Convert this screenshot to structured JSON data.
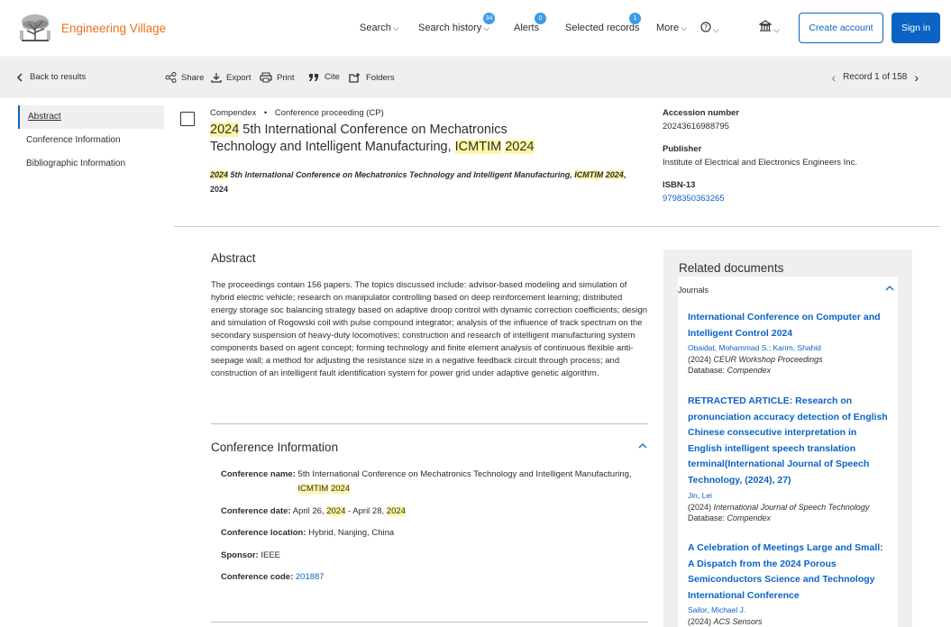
{
  "header": {
    "brand": "Engineering Village",
    "nav": [
      {
        "label": "Search",
        "badge": ""
      },
      {
        "label": "Search history",
        "badge": "34"
      },
      {
        "label": "Alerts",
        "badge": "0"
      },
      {
        "label": "Selected records",
        "badge": "1"
      },
      {
        "label": "More",
        "badge": ""
      }
    ],
    "create_account": "Create account",
    "sign_in": "Sign in"
  },
  "toolbar": {
    "back": "Back to results",
    "share": "Share",
    "export": "Export",
    "print": "Print",
    "cite": "Cite",
    "folders": "Folders",
    "record": "Record 1 of 158"
  },
  "leftnav": [
    "Abstract",
    "Conference Information",
    "Bibliographic Information"
  ],
  "record": {
    "database": "Compendex",
    "doc_type": "Conference proceeding (CP)",
    "title_year": "2024",
    "title_mid": " 5th International Conference on Mechatronics Technology and Intelligent Manufacturing, ",
    "title_acr": "ICMTIM",
    "title_space": " ",
    "title_year2": "2024",
    "source_year": "2024",
    "source_mid": " 5th International Conference on Mechatronics Technology and Intelligent Manufacturing, ",
    "source_acr": "ICMTIM",
    "source_year2": "2024",
    "source_tail": ", 2024"
  },
  "side": {
    "accession_label": "Accession number",
    "accession_value": "20243616988795",
    "publisher_label": "Publisher",
    "publisher_value": "Institute of Electrical and Electronics Engineers Inc.",
    "isbn_label": "ISBN-13",
    "isbn_value": "9798350363265"
  },
  "abstract": {
    "heading": "Abstract",
    "text": "The proceedings contain 156 papers. The topics discussed include: advisor-based modeling and simulation of hybrid electric vehicle; research on manipulator controlling based on deep reinforcement learning; distributed energy storage soc balancing strategy based on adaptive droop control with dynamic correction coefficients; design and simulation of Rogowski coil with pulse compound integrator; analysis of the influence of track spectrum on the secondary suspension of heavy-duty locomotives; construction and research of intelligent manufacturing system components based on agent concept; forming technology and finite element analysis of continuous flexible anti-seepage wall; a method for adjusting the resistance size in a negative feedback circuit through process; and construction of an intelligent fault identification system for power grid under adaptive genetic algorithm."
  },
  "conference": {
    "heading": "Conference Information",
    "name_label": "Conference name:",
    "name_value": "5th International Conference on Mechatronics Technology and Intelligent Manufacturing, ",
    "name_acr": "ICMTIM",
    "name_year": "2024",
    "date_label": "Conference date:",
    "date_start": "April 26, ",
    "date_y1": "2024",
    "date_mid": " - April 28, ",
    "date_y2": "2024",
    "location_label": "Conference location:",
    "location_value": "Hybrid, Nanjing, China",
    "sponsor_label": "Sponsor:",
    "sponsor_value": "IEEE",
    "code_label": "Conference code:",
    "code_value": "201887"
  },
  "related": {
    "heading": "Related documents",
    "group": "Journals",
    "items": [
      {
        "title": "International Conference on Computer and Intelligent Control 2024",
        "authors": "Obaidat, Mohammad S.; Karim, Shahid",
        "year": "(2024) ",
        "source": "CEUR Workshop Proceedings",
        "db_label": "Database: ",
        "db": "Compendex"
      },
      {
        "title": "RETRACTED ARTICLE: Research on pronunciation accuracy detection of English Chinese consecutive interpretation in English intelligent speech translation terminal(International Journal of Speech Technology, (2024), 27)",
        "authors": "Jin, Lei",
        "year": "(2024) ",
        "source": "International Journal of Speech Technology",
        "db_label": "Database: ",
        "db": "Compendex"
      },
      {
        "title": "A Celebration of Meetings Large and Small: A Dispatch from the 2024 Porous Semiconductors Science and Technology International Conference",
        "authors": "Sailor, Michael J.",
        "year": "(2024) ",
        "source": "ACS Sensors",
        "db_label": "",
        "db": ""
      }
    ]
  }
}
